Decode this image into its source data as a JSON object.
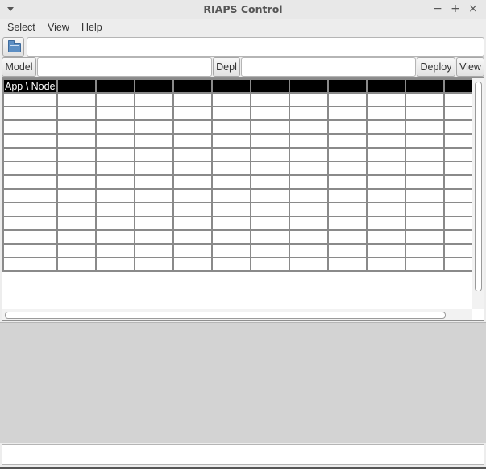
{
  "window": {
    "title": "RIAPS Control",
    "minimize_glyph": "−",
    "maximize_glyph": "+",
    "close_glyph": "×"
  },
  "menu": {
    "items": [
      "Select",
      "View",
      "Help"
    ]
  },
  "toolbar": {
    "open_icon": "folder-open-icon",
    "path_value": ""
  },
  "model_row": {
    "model_button": "Model",
    "model_value": "",
    "depl_button": "Depl",
    "depl_value": "",
    "deploy_button": "Deploy",
    "view_button": "View"
  },
  "table": {
    "header_first": "App \\ Node",
    "column_count": 12,
    "row_count": 14
  },
  "status": {
    "value": ""
  },
  "colors": {
    "header_bg": "#000000",
    "header_fg": "#ffffff",
    "grid_line": "#8a8a8a",
    "log_bg": "#d3d3d3"
  }
}
